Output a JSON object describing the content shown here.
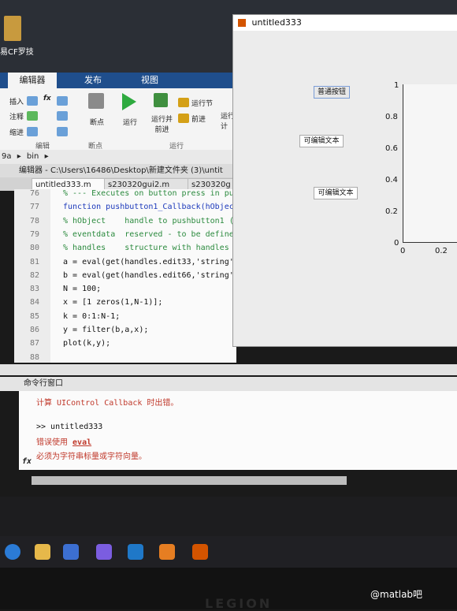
{
  "desktop": {
    "icon_label": "易CF罗技"
  },
  "ribbon": {
    "tabs": [
      "编辑器",
      "发布",
      "视图"
    ],
    "small": [
      "插入",
      "注释",
      "缩进",
      "断点",
      "运行",
      "运行并\n前进",
      "运行节",
      "前进",
      "运行\n计"
    ],
    "fx": "fx",
    "groups": [
      "编辑",
      "断点",
      "运行"
    ]
  },
  "path": {
    "prefix": "9a",
    "crumb": "bin"
  },
  "editor": {
    "header": "编辑器 - C:\\Users\\16486\\Desktop\\新建文件夹 (3)\\untit",
    "tabs": [
      "untitled333.m",
      "s230320gui2.m",
      "s230320g"
    ],
    "lines": [
      {
        "n": "76",
        "code": "% --- Executes on button press in pu",
        "cls": "cmt"
      },
      {
        "n": "77",
        "code": "function pushbutton1_Callback(hObjec",
        "cls": "kw"
      },
      {
        "n": "78",
        "code": "% hObject    handle to pushbutton1 (",
        "cls": "cmt"
      },
      {
        "n": "79",
        "code": "% eventdata  reserved - to be define",
        "cls": "cmt"
      },
      {
        "n": "80",
        "code": "% handles    structure with handles",
        "cls": "cmt"
      },
      {
        "n": "81",
        "code": "a = eval(get(handles.edit33,'string'",
        "cls": ""
      },
      {
        "n": "82",
        "code": "b = eval(get(handles.edit66,'string'",
        "cls": ""
      },
      {
        "n": "83",
        "code": "N = 100;",
        "cls": ""
      },
      {
        "n": "84",
        "code": "x = [1 zeros(1,N-1)];",
        "cls": ""
      },
      {
        "n": "85",
        "code": "k = 0:1:N-1;",
        "cls": ""
      },
      {
        "n": "86",
        "code": "y = filter(b,a,x);",
        "cls": ""
      },
      {
        "n": "87",
        "code": "plot(k,y);",
        "cls": ""
      },
      {
        "n": "88",
        "code": "",
        "cls": ""
      }
    ]
  },
  "command_window": {
    "title": "命令行窗口",
    "error1": "计算 UIControl Callback 时出错。",
    "prompt": ">> untitled333",
    "error2_prefix": "错误使用 ",
    "error2_link": "eval",
    "error3": "必须为字符串标量或字符向量。",
    "fx": "fx"
  },
  "figure": {
    "title": "untitled333",
    "button": "普通按钮",
    "edit1": "可编辑文本",
    "edit2": "可编辑文本",
    "yticks": [
      "1",
      "0.8",
      "0.6",
      "0.4",
      "0.2",
      "0"
    ],
    "xticks": [
      "0",
      "0.2"
    ]
  },
  "watermark": "@matlab吧",
  "laptop_brand": "LEGION"
}
